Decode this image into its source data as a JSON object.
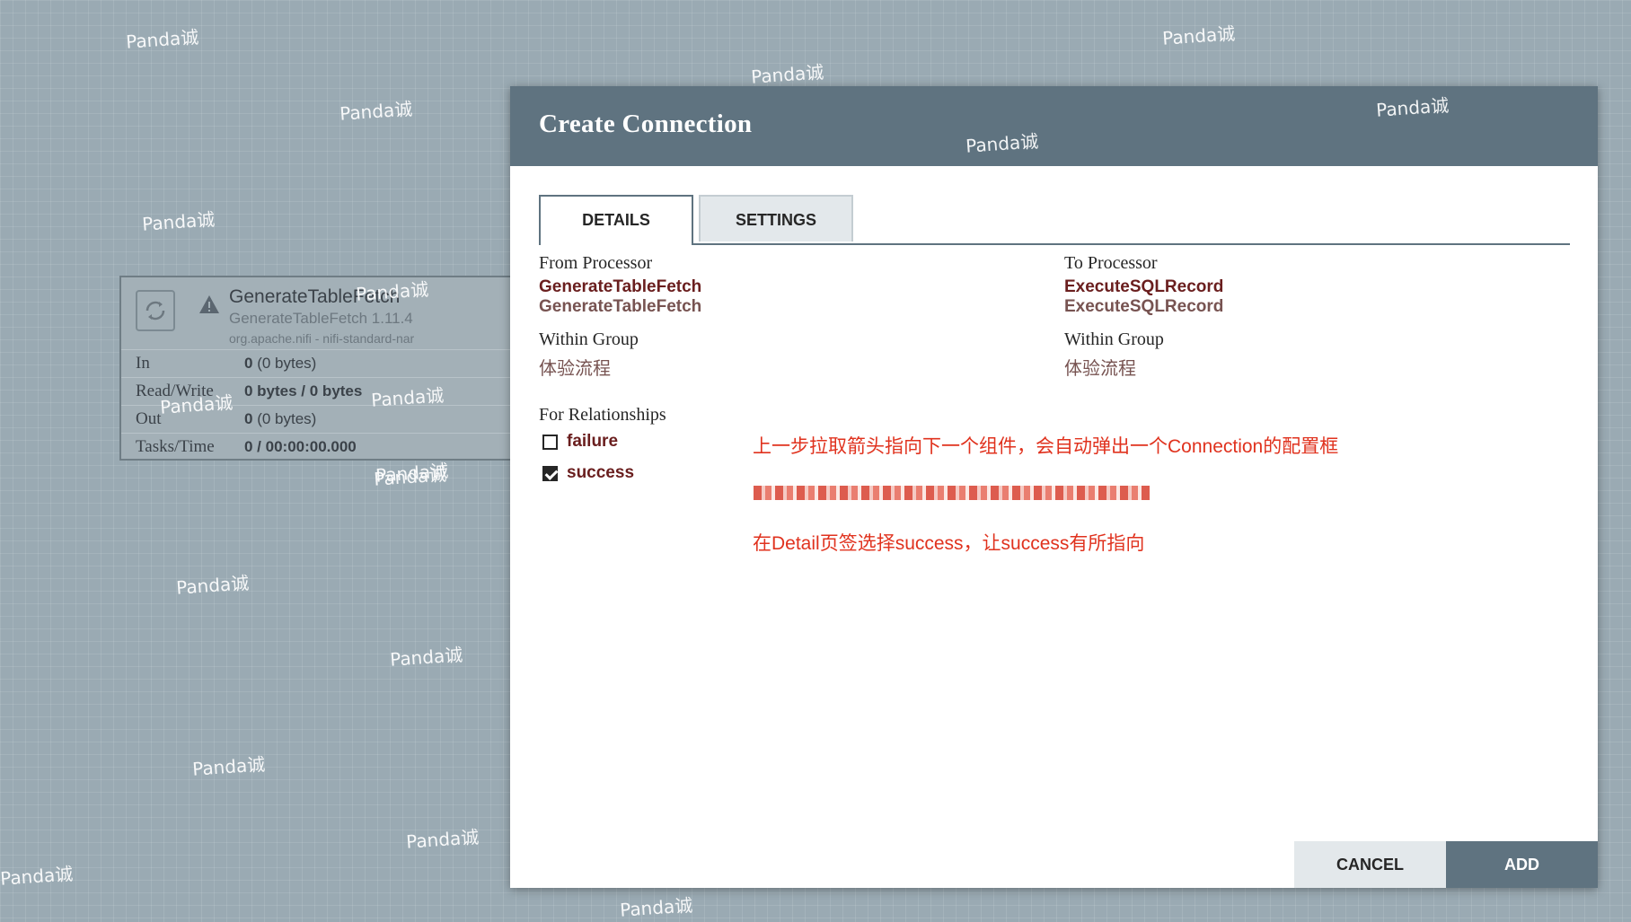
{
  "processor": {
    "name": "GenerateTableFetch",
    "type": "GenerateTableFetch 1.11.4",
    "bundle": "org.apache.nifi - nifi-standard-nar",
    "stats": [
      {
        "label": "In",
        "value": "0",
        "detail": " (0 bytes)"
      },
      {
        "label": "Read/Write",
        "value": "0 bytes / 0 bytes",
        "detail": ""
      },
      {
        "label": "Out",
        "value": "0",
        "detail": " (0 bytes)"
      },
      {
        "label": "Tasks/Time",
        "value": "0 / 00:00:00.000",
        "detail": ""
      }
    ]
  },
  "dialog": {
    "title": "Create Connection",
    "tabs": [
      "DETAILS",
      "SETTINGS"
    ],
    "from": {
      "label": "From Processor",
      "name": "GenerateTableFetch",
      "type": "GenerateTableFetch",
      "group_label": "Within Group",
      "group": "体验流程"
    },
    "to": {
      "label": "To Processor",
      "name": "ExecuteSQLRecord",
      "type": "ExecuteSQLRecord",
      "group_label": "Within Group",
      "group": "体验流程"
    },
    "relationships": {
      "label": "For Relationships",
      "items": [
        {
          "name": "failure",
          "checked": false
        },
        {
          "name": "success",
          "checked": true
        }
      ]
    },
    "annotations": [
      "上一步拉取箭头指向下一个组件，会自动弹出一个Connection的配置框",
      "在Detail页签选择success，让success有所指向"
    ],
    "buttons": {
      "cancel": "CANCEL",
      "add": "ADD"
    }
  },
  "watermark": "Panda诚",
  "colors": {
    "canvas": "#9aaab3",
    "header": "#5f7380",
    "accent_value": "#6a1e1e",
    "annotation": "#e0321e"
  }
}
